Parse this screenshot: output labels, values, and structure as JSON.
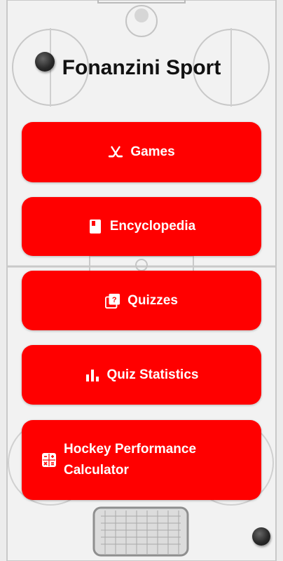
{
  "app": {
    "title": "Fonanzini Sport"
  },
  "menu": {
    "items": [
      {
        "label": "Games",
        "icon": "hockey-sticks-icon"
      },
      {
        "label": "Encyclopedia",
        "icon": "book-icon"
      },
      {
        "label": "Quizzes",
        "icon": "quiz-icon"
      },
      {
        "label": "Quiz Statistics",
        "icon": "bar-chart-icon"
      },
      {
        "label_line1": "Hockey Performance",
        "label_line2": "Calculator",
        "icon": "calculator-icon"
      }
    ]
  },
  "colors": {
    "button": "#ff0000",
    "text": "#ffffff",
    "title": "#111111"
  }
}
